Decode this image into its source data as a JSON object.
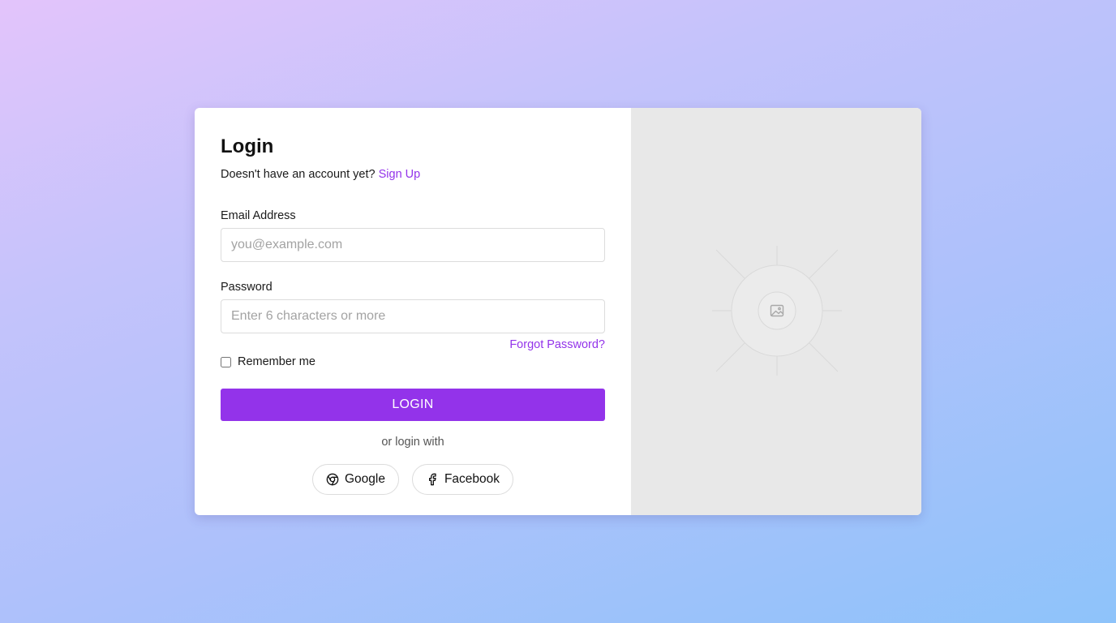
{
  "login": {
    "title": "Login",
    "subtitle_text": "Doesn't have an account yet?",
    "signup_link": "Sign Up",
    "email": {
      "label": "Email Address",
      "placeholder": "you@example.com",
      "value": ""
    },
    "password": {
      "label": "Password",
      "placeholder": "Enter 6 characters or more",
      "value": ""
    },
    "forgot_password": "Forgot Password?",
    "remember_me": {
      "label": "Remember me",
      "checked": false
    },
    "login_button": "LOGIN",
    "or_text": "or login with",
    "social": {
      "google": {
        "label": "Google",
        "icon": "chrome-icon"
      },
      "facebook": {
        "label": "Facebook",
        "icon": "facebook-icon"
      }
    }
  },
  "image_panel": {
    "icon": "image-placeholder-icon"
  },
  "colors": {
    "accent": "#9333ea",
    "image_panel_bg": "#e8e8e8"
  }
}
